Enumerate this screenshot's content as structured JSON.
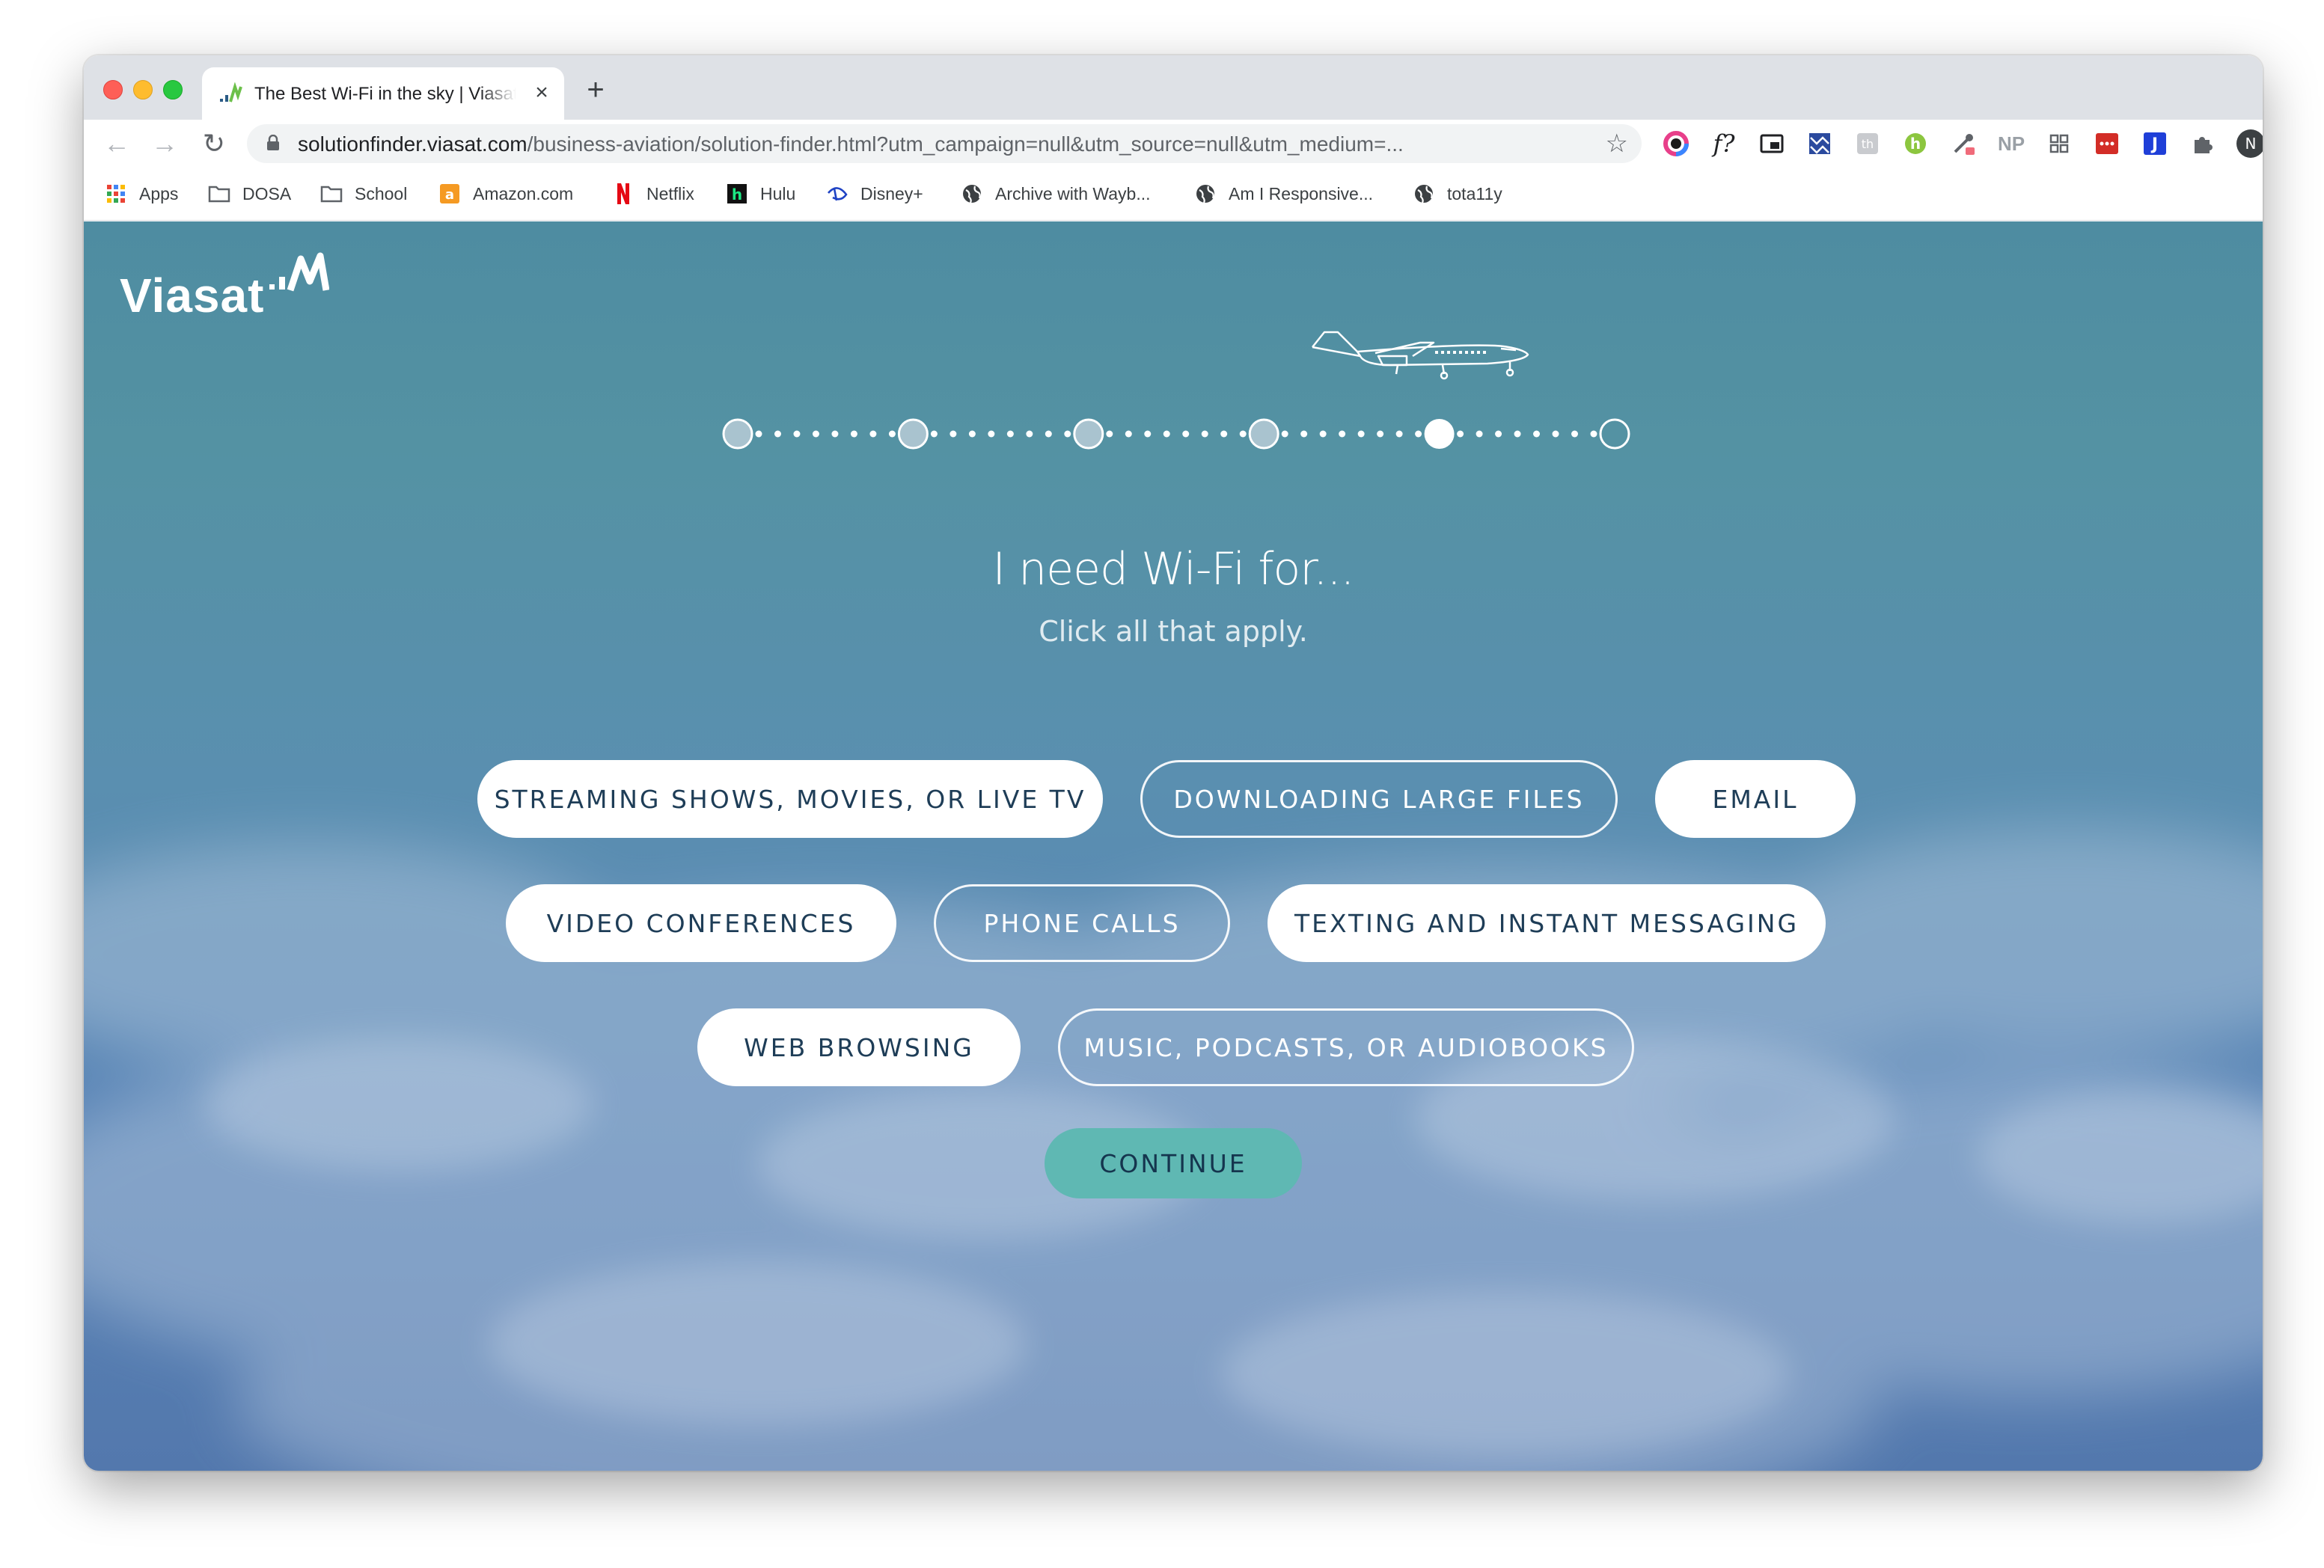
{
  "browser": {
    "tab": {
      "title": "The Best Wi-Fi in the sky | Viasat"
    },
    "address_bar": {
      "host": "solutionfinder.viasat.com",
      "path": "/business-aviation/solution-finder.html?utm_campaign=null&utm_source=null&utm_medium=..."
    },
    "extensions": [
      {
        "icon": "color-picker-icon",
        "label": ""
      },
      {
        "icon": "font-identifier-icon",
        "label": "f?"
      },
      {
        "icon": "picture-in-picture-icon",
        "label": ""
      },
      {
        "icon": "pattern-extension-icon",
        "label": ""
      },
      {
        "icon": "grey-extension-icon",
        "label": ""
      },
      {
        "icon": "honey-extension-icon",
        "label": "h"
      },
      {
        "icon": "eyedropper-extension-icon",
        "label": ""
      },
      {
        "icon": "np-extension-icon",
        "label": "NP"
      },
      {
        "icon": "grid-extension-icon",
        "label": ""
      },
      {
        "icon": "lastpass-extension-icon",
        "label": ""
      },
      {
        "icon": "j-extension-icon",
        "label": "J"
      },
      {
        "icon": "extensions-puzzle-icon",
        "label": ""
      },
      {
        "icon": "profile-avatar-icon",
        "label": "N"
      },
      {
        "icon": "update-arrow-icon",
        "label": ""
      }
    ],
    "bookmarks": [
      {
        "label": "Apps",
        "icon": "apps-grid-icon"
      },
      {
        "label": "DOSA",
        "icon": "folder-icon"
      },
      {
        "label": "School",
        "icon": "folder-icon"
      },
      {
        "label": "Amazon.com",
        "icon": "amazon-icon"
      },
      {
        "label": "Netflix",
        "icon": "netflix-icon"
      },
      {
        "label": "Hulu",
        "icon": "hulu-icon"
      },
      {
        "label": "Disney+",
        "icon": "disney-icon"
      },
      {
        "label": "Archive with Wayb...",
        "icon": "globe-icon"
      },
      {
        "label": "Am I Responsive...",
        "icon": "globe-icon"
      },
      {
        "label": "tota11y",
        "icon": "globe-icon"
      }
    ]
  },
  "page": {
    "logo_text": "Viasat",
    "progress": {
      "total_steps": 6,
      "current_step": 5
    },
    "headline": "I need Wi-Fi for...",
    "subhead": "Click all that apply.",
    "options": [
      {
        "label": "STREAMING SHOWS, MOVIES, OR LIVE TV",
        "selected": true
      },
      {
        "label": "DOWNLOADING LARGE FILES",
        "selected": false
      },
      {
        "label": "EMAIL",
        "selected": true
      },
      {
        "label": "VIDEO CONFERENCES",
        "selected": true
      },
      {
        "label": "PHONE CALLS",
        "selected": false
      },
      {
        "label": "TEXTING AND INSTANT MESSAGING",
        "selected": true
      },
      {
        "label": "WEB BROWSING",
        "selected": true
      },
      {
        "label": "MUSIC, PODCASTS, OR AUDIOBOOKS",
        "selected": false
      }
    ],
    "continue_label": "CONTINUE"
  }
}
